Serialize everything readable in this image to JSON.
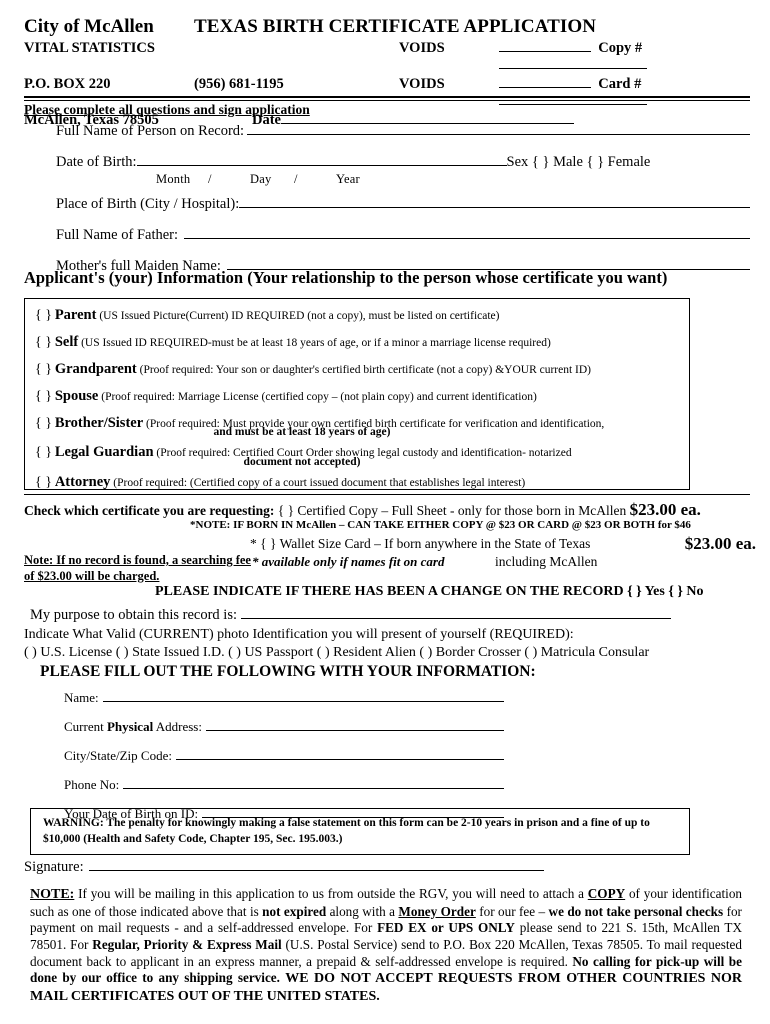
{
  "header": {
    "city": "City of McAllen",
    "title": "TEXAS BIRTH CERTIFICATE APPLICATION",
    "dept": "VITAL STATISTICS",
    "po_box": "P.O. BOX 220",
    "phone": "(956) 681-1195",
    "city_state_zip": "McAllen, Texas 78505",
    "voids_label_1": "VOIDS",
    "voids_label_2": "VOIDS",
    "copy_label": "Copy #",
    "card_label": "Card #",
    "date_label": "Date",
    "instruction": "Please complete all questions and sign application"
  },
  "record": {
    "full_name_label": "Full Name of Person on Record:",
    "dob_label": "Date of Birth:",
    "month": "Month",
    "slash1": "/",
    "day": "Day",
    "slash2": "/",
    "year": "Year",
    "sex_label": "Sex",
    "male": "{ } Male",
    "female": "{ } Female",
    "place_label": "Place of Birth (City / Hospital):",
    "father_label": "Full Name of Father:",
    "mother_label": "Mother's full Maiden Name:"
  },
  "applicant": {
    "heading": "Applicant's (your) Information (Your relationship to the person whose certificate you want)",
    "relationships": [
      {
        "checkbox": "{ }",
        "name": "Parent",
        "detail": "(US Issued Picture(Current) ID REQUIRED (not a copy), must be listed on certificate)",
        "continuation": ""
      },
      {
        "checkbox": "{ }",
        "name": "Self",
        "detail": "(US Issued ID REQUIRED-must be at least 18 years of age, or if a minor a marriage license required)",
        "continuation": ""
      },
      {
        "checkbox": "{ }",
        "name": "Grandparent",
        "detail": "(Proof required: Your son or daughter's certified birth certificate (not a copy) &YOUR current ID)",
        "continuation": ""
      },
      {
        "checkbox": "{ }",
        "name": "Spouse",
        "detail": "(Proof required: Marriage License (certified copy – (not plain copy) and current identification)",
        "continuation": ""
      },
      {
        "checkbox": "{ }",
        "name": "Brother/Sister",
        "detail": "(Proof required: Must provide your own certified birth certificate for verification and identification,",
        "continuation": "and must be at least 18 years of age)"
      },
      {
        "checkbox": "{ }",
        "name": "Legal Guardian",
        "detail": "(Proof required: Certified Court Order showing legal custody and identification- notarized",
        "continuation": "document not accepted)"
      },
      {
        "checkbox": "{ }",
        "name": "Attorney",
        "detail": "(Proof required: (Certified copy of a court issued document that establishes legal interest)",
        "continuation": ""
      }
    ]
  },
  "certificate": {
    "check_label": "Check which certificate you are requesting:",
    "certified_copy_option": "{   } Certified Copy – Full Sheet - only for those born in McAllen",
    "certified_copy_price": "$23.00 ea.",
    "note_both": "*NOTE:  IF BORN IN McAllen – CAN TAKE EITHER COPY @ $23 OR CARD @ $23 OR BOTH for $46",
    "wallet_option": "* {   } Wallet Size Card –   If born anywhere in the State of Texas",
    "wallet_price": "$23.00 ea.",
    "search_note": "Note:   If no record is found, a searching fee of $23.00 will be charged.",
    "available_note": "* available only if names fit on card",
    "including_mcallen": "including McAllen",
    "change_record": "PLEASE INDICATE IF THERE HAS BEEN A CHANGE ON THE RECORD   {   } Yes   {   } No",
    "purpose_label": "My purpose to obtain this record is:"
  },
  "identification": {
    "indicate_label": "Indicate What Valid (CURRENT) photo Identification you will present of yourself (REQUIRED):",
    "options": "(  ) U.S. License (  ) State Issued I.D.  (  ) US Passport   (  ) Resident Alien (  ) Border Crosser   (  ) Matricula Consular",
    "fill_out_heading": "PLEASE FILL OUT THE FOLLOWING WITH YOUR INFORMATION:"
  },
  "applicant_fields": {
    "name_label": "Name:",
    "address_label_pre": "Current ",
    "address_label_bold": "Physical",
    "address_label_post": " Address:",
    "city_state_zip_label": "City/State/Zip Code:",
    "phone_label": "Phone No:",
    "dob_label": "Your Date of Birth on ID:"
  },
  "warning": {
    "text": "WARNING: The penalty for knowingly making a false statement on this form can be 2-10 years in prison and a fine of up to $10,000 (Health and Safety Code, Chapter 195, Sec. 195.003.)"
  },
  "signature": {
    "label": "Signature:"
  },
  "footer": {
    "note_label": "NOTE:",
    "p1": " If you will be mailing in this application to us from outside the RGV, you will need to attach a ",
    "copy_word": "COPY",
    "p2": " of your identification such as one of those indicated above that is ",
    "not_expired": "not expired",
    "p3": " along with a ",
    "money_order": "Money Order",
    "p4": " for our fee – ",
    "no_checks": "we do not take personal checks",
    "p5": " for payment on mail requests - and a self-addressed envelope. For ",
    "fedex": "FED EX or UPS ONLY",
    "p6": " please send to 221 S. 15th, McAllen TX 78501. For  ",
    "regular_mail": "Regular, Priority & Express Mail ",
    "postal": "(U.S. Postal Service)",
    "p7": " send to P.O. Box 220 McAllen, Texas 78505. To mail requested document back to applicant in an express manner, a prepaid & self-addressed envelope is required. ",
    "no_calling": "No calling for pick-up will be done by our office to any shipping service.",
    "p8": " ",
    "no_accept": "WE DO NOT ACCEPT REQUESTS FROM OTHER COUNTRIES NOR MAIL CERTIFICATES OUT OF THE UNITED STATES."
  }
}
